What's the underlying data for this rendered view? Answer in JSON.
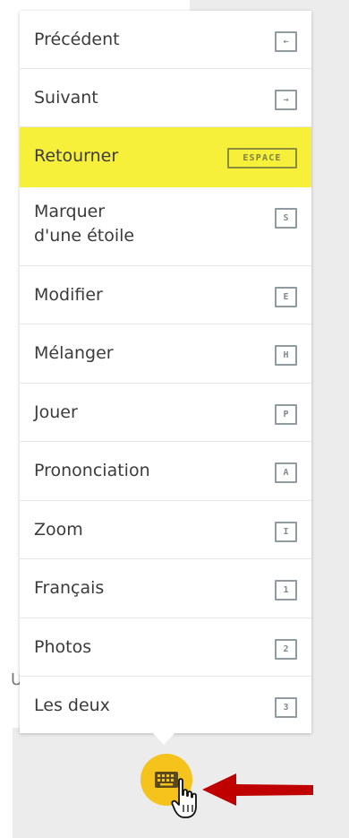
{
  "menu": {
    "items": [
      {
        "label": "Précédent",
        "shortcut": "←"
      },
      {
        "label": "Suivant",
        "shortcut": "→"
      },
      {
        "label": "Retourner",
        "shortcut": "ESPACE",
        "highlighted": true
      },
      {
        "label": "Marquer\nd'une étoile",
        "shortcut": "S"
      },
      {
        "label": "Modifier",
        "shortcut": "E"
      },
      {
        "label": "Mélanger",
        "shortcut": "H"
      },
      {
        "label": "Jouer",
        "shortcut": "P"
      },
      {
        "label": "Prononciation",
        "shortcut": "A"
      },
      {
        "label": "Zoom",
        "shortcut": "I"
      },
      {
        "label": "Français",
        "shortcut": "1"
      },
      {
        "label": "Photos",
        "shortcut": "2"
      },
      {
        "label": "Les deux",
        "shortcut": "3"
      }
    ]
  },
  "background": {
    "partial_text": "U"
  },
  "icons": {
    "toggle": "keyboard-icon",
    "cursor": "hand-pointer-icon",
    "annotation": "red-arrow-icon"
  },
  "colors": {
    "highlight": "#f7f03a",
    "toggle_button": "#f5c31b",
    "arrow": "#c00000",
    "key_border": "#8f9ba1"
  }
}
